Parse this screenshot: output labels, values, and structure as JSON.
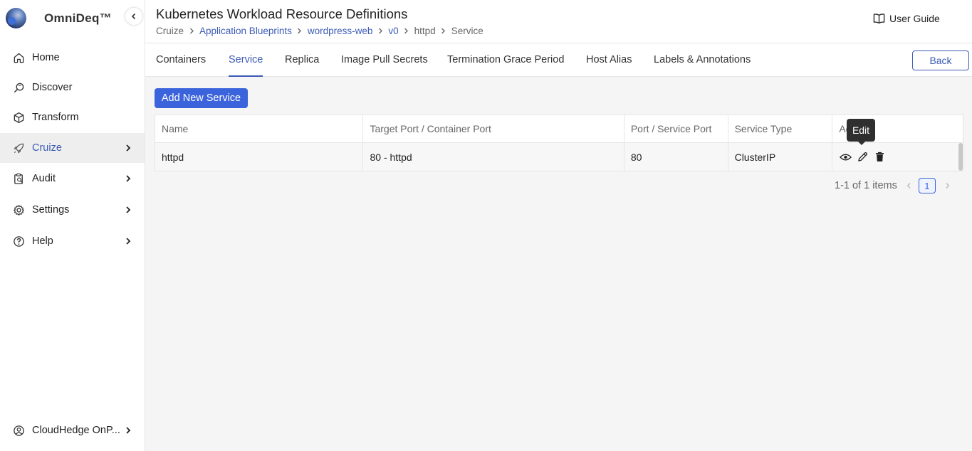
{
  "brand": {
    "name": "OmniDeq™"
  },
  "sidebar": {
    "items": [
      {
        "label": "Home",
        "icon": "home-icon"
      },
      {
        "label": "Discover",
        "icon": "discover-icon"
      },
      {
        "label": "Transform",
        "icon": "cube-icon"
      },
      {
        "label": "Cruize",
        "icon": "rocket-icon",
        "active": true
      },
      {
        "label": "Audit",
        "icon": "audit-icon"
      },
      {
        "label": "Settings",
        "icon": "gear-icon"
      },
      {
        "label": "Help",
        "icon": "help-icon"
      }
    ],
    "account": {
      "label": "CloudHedge OnP...",
      "icon": "account-icon"
    }
  },
  "header": {
    "title": "Kubernetes Workload Resource Definitions",
    "breadcrumb": [
      "Cruize",
      "Application Blueprints",
      "wordpress-web",
      "v0",
      "httpd",
      "Service"
    ],
    "user_guide": "User Guide"
  },
  "tabs": [
    "Containers",
    "Service",
    "Replica",
    "Image Pull Secrets",
    "Termination Grace Period",
    "Host Alias",
    "Labels & Annotations"
  ],
  "active_tab": "Service",
  "back_label": "Back",
  "add_button": "Add New Service",
  "table": {
    "headers": [
      "Name",
      "Target Port / Container Port",
      "Port / Service Port",
      "Service Type",
      "Ac"
    ],
    "rows": [
      {
        "name": "httpd",
        "target_port": "80 - httpd",
        "service_port": "80",
        "service_type": "ClusterIP"
      }
    ]
  },
  "tooltip": "Edit",
  "pagination": {
    "summary": "1-1 of 1 items",
    "current_page": "1"
  },
  "colors": {
    "accent": "#3b63dc",
    "link": "#3b5bb5",
    "active_bg": "#eeeeee",
    "content_bg": "#f5f5f5"
  }
}
